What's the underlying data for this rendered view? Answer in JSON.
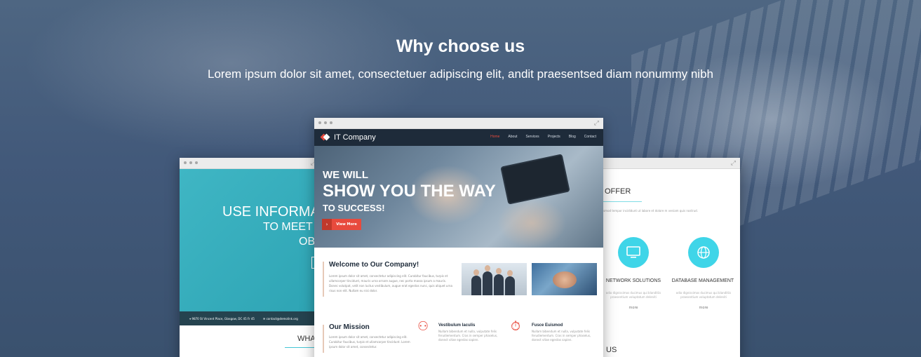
{
  "heading": {
    "title": "Why choose us",
    "subtitle": "Lorem ipsum dolor sit amet, consectetuer adipiscing elit, andit praesentsed diam nonummy nibh"
  },
  "left_template": {
    "hero_line1": "USE INFORMAT",
    "hero_line2": "TO MEET",
    "hero_line3": "OB",
    "contact_address": "9870 St Vincent Place, Glasgow, DC 45 Fr 45",
    "contact_email": "contact@demolink.org",
    "section_label": "WHAT"
  },
  "center_template": {
    "brand": "IT Company",
    "nav": [
      "Home",
      "About",
      "Services",
      "Projects",
      "Blog",
      "Contact"
    ],
    "nav_active": "Home",
    "hero_line1": "WE WILL",
    "hero_line2": "SHOW YOU THE WAY",
    "hero_line3": "TO SUCCESS!",
    "cta_label": "View More",
    "welcome_title": "Welcome to Our Company!",
    "welcome_text": "Lorem ipsum dolor sit amet, consectetur adipiscing elit. Curabitur faucibus, turpis et ullamcorper tincidunt, mauris urna ornare augue, nec porta massa ipsum a mauris. Donec volutpat, velit non luctus vestibulum, augue erat egestas nunc, quis aliquet urna risus non elit. Nullam eu nisi dolor.",
    "mission_title": "Our Mission",
    "mission_text": "Lorem ipsum dolor sit amet, consectetur adipiscing elit. Curabitur faucibus, turpis et ullamcorper tincidunt. Lorem ipsum dolor sit amet, consectetur.",
    "feature1_title": "Vestibulum Iaculis",
    "feature1_text": "Nullam bibendum et nulla, vulputate felis ferudiementum. Cras in semper phaselus, donect vitae egestas sapien.",
    "feature2_title": "Fusce Euismod",
    "feature2_text": "Nullam bibendum et nulla, vulputate felis ferudiementum. Cras in semper phaselus, donect vitae egestas sapien."
  },
  "right_template": {
    "section_title": "OFFER",
    "section_text": "d m eiusmod tempor incididunt ut labore et dolore m veniam quis nostrud.",
    "service1_title": "NETWORK SOLUTIONS",
    "service2_title": "DATABASE MANAGEMENT",
    "service_text": "odio dignissimos ducimus qui blanditiis praesentium voluptatum deleniti",
    "more_label": "more",
    "footer_label": "US"
  },
  "colors": {
    "accent_red": "#e84a3d",
    "teal": "#3fb6c4",
    "cyan_icon": "#3fd5e8",
    "nav_dark": "#1e2b3a"
  }
}
